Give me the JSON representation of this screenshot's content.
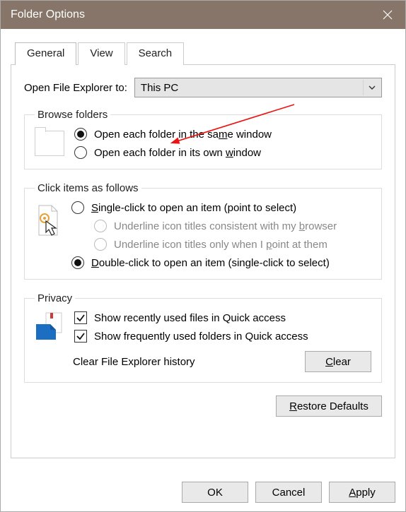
{
  "title": "Folder Options",
  "tabs": {
    "general": "General",
    "view": "View",
    "search": "Search"
  },
  "open_row": {
    "label": "Open File Explorer to:",
    "value": "This PC"
  },
  "browse": {
    "legend": "Browse folders",
    "same_pre": "Open each folder in the sa",
    "same_u": "m",
    "same_post": "e window",
    "own_pre": "Open each folder in its own ",
    "own_u": "w",
    "own_post": "indow"
  },
  "click": {
    "legend": "Click items as follows",
    "single_u": "S",
    "single_post": "ingle-click to open an item (point to select)",
    "sub1_pre": "Underline icon titles consistent with my ",
    "sub1_u": "b",
    "sub1_post": "rowser",
    "sub2_pre": "Underline icon titles only when I ",
    "sub2_u": "p",
    "sub2_post": "oint at them",
    "double_u": "D",
    "double_post": "ouble-click to open an item (single-click to select)"
  },
  "privacy": {
    "legend": "Privacy",
    "recent": "Show recently used files in Quick access",
    "frequent": "Show frequently used folders in Quick access",
    "clear_label": "Clear File Explorer history",
    "clear_btn_u": "C",
    "clear_btn_post": "lear"
  },
  "restore": {
    "u": "R",
    "post": "estore Defaults"
  },
  "footer": {
    "ok": "OK",
    "cancel": "Cancel",
    "apply_u": "A",
    "apply_post": "pply"
  }
}
